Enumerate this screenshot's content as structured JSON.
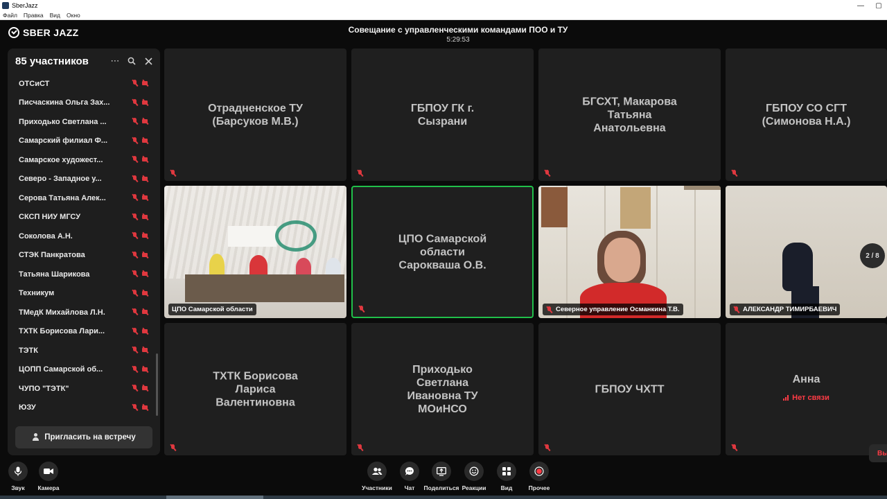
{
  "window": {
    "title": "SberJazz",
    "menu": [
      "Файл",
      "Правка",
      "Вид",
      "Окно"
    ]
  },
  "app": {
    "logo": "SBER JAZZ",
    "meeting_title": "Совещание с управленческими командами ПОО и ТУ",
    "timer": "5:29:53"
  },
  "sidebar": {
    "header": "85 участников",
    "participants": [
      "ОТСиСТ",
      "Писчаскина Ольга Зах...",
      "Приходько Светлана ...",
      "Самарский филиал Ф...",
      "Самарское художест...",
      "Северо - Западное у...",
      "Серова Татьяна Алек...",
      "СКСП НИУ МГСУ",
      "Соколова А.Н.",
      "СТЭК Панкратова",
      "Татьяна Шарикова",
      "Техникум",
      "ТМедК Михайлова Л.Н.",
      "ТХТК Борисова Лари...",
      "ТЭТК",
      "ЦОПП Самарской об...",
      "ЧУПО \"ТЭТК\"",
      "ЮЗУ"
    ],
    "invite_label": "Пригласить на встречу"
  },
  "tiles": [
    {
      "name": "Отрадненское ТУ\n(Барсуков М.В.)"
    },
    {
      "name": "ГБПОУ  ГК г.\nСызрани"
    },
    {
      "name": "БГСХТ, Макарова\nТатьяна\nАнатольевна"
    },
    {
      "name": "ГБПОУ СО СГТ\n(Симонова Н.А.)"
    },
    {
      "label": "ЦПО Самарской области"
    },
    {
      "name": "ЦПО Самарской\nобласти\nСарокваша О.В."
    },
    {
      "label": "Северное управление Османкина Т.В."
    },
    {
      "label": "АЛЕКСАНДР ТИМИРБАЕВИЧ"
    },
    {
      "name": "ТХТК Борисова\nЛариса\nВалентиновна"
    },
    {
      "name": "Приходько\nСветлана\nИвановна ТУ\nМОиНСО"
    },
    {
      "name": "ГБПОУ ЧХТТ"
    },
    {
      "name": "Анна",
      "status": "Нет связи"
    }
  ],
  "page_indicator": "2 / 8",
  "toolbar": {
    "sound": "Звук",
    "camera": "Камера",
    "participants": "Участники",
    "chat": "Чат",
    "share": "Поделиться",
    "reactions": "Реакции",
    "view": "Вид",
    "more": "Прочее",
    "exit": "Вы"
  },
  "colors": {
    "accent_active": "#21c04a",
    "muted_icon": "#e0383f",
    "no_connection": "#ff3b45"
  }
}
